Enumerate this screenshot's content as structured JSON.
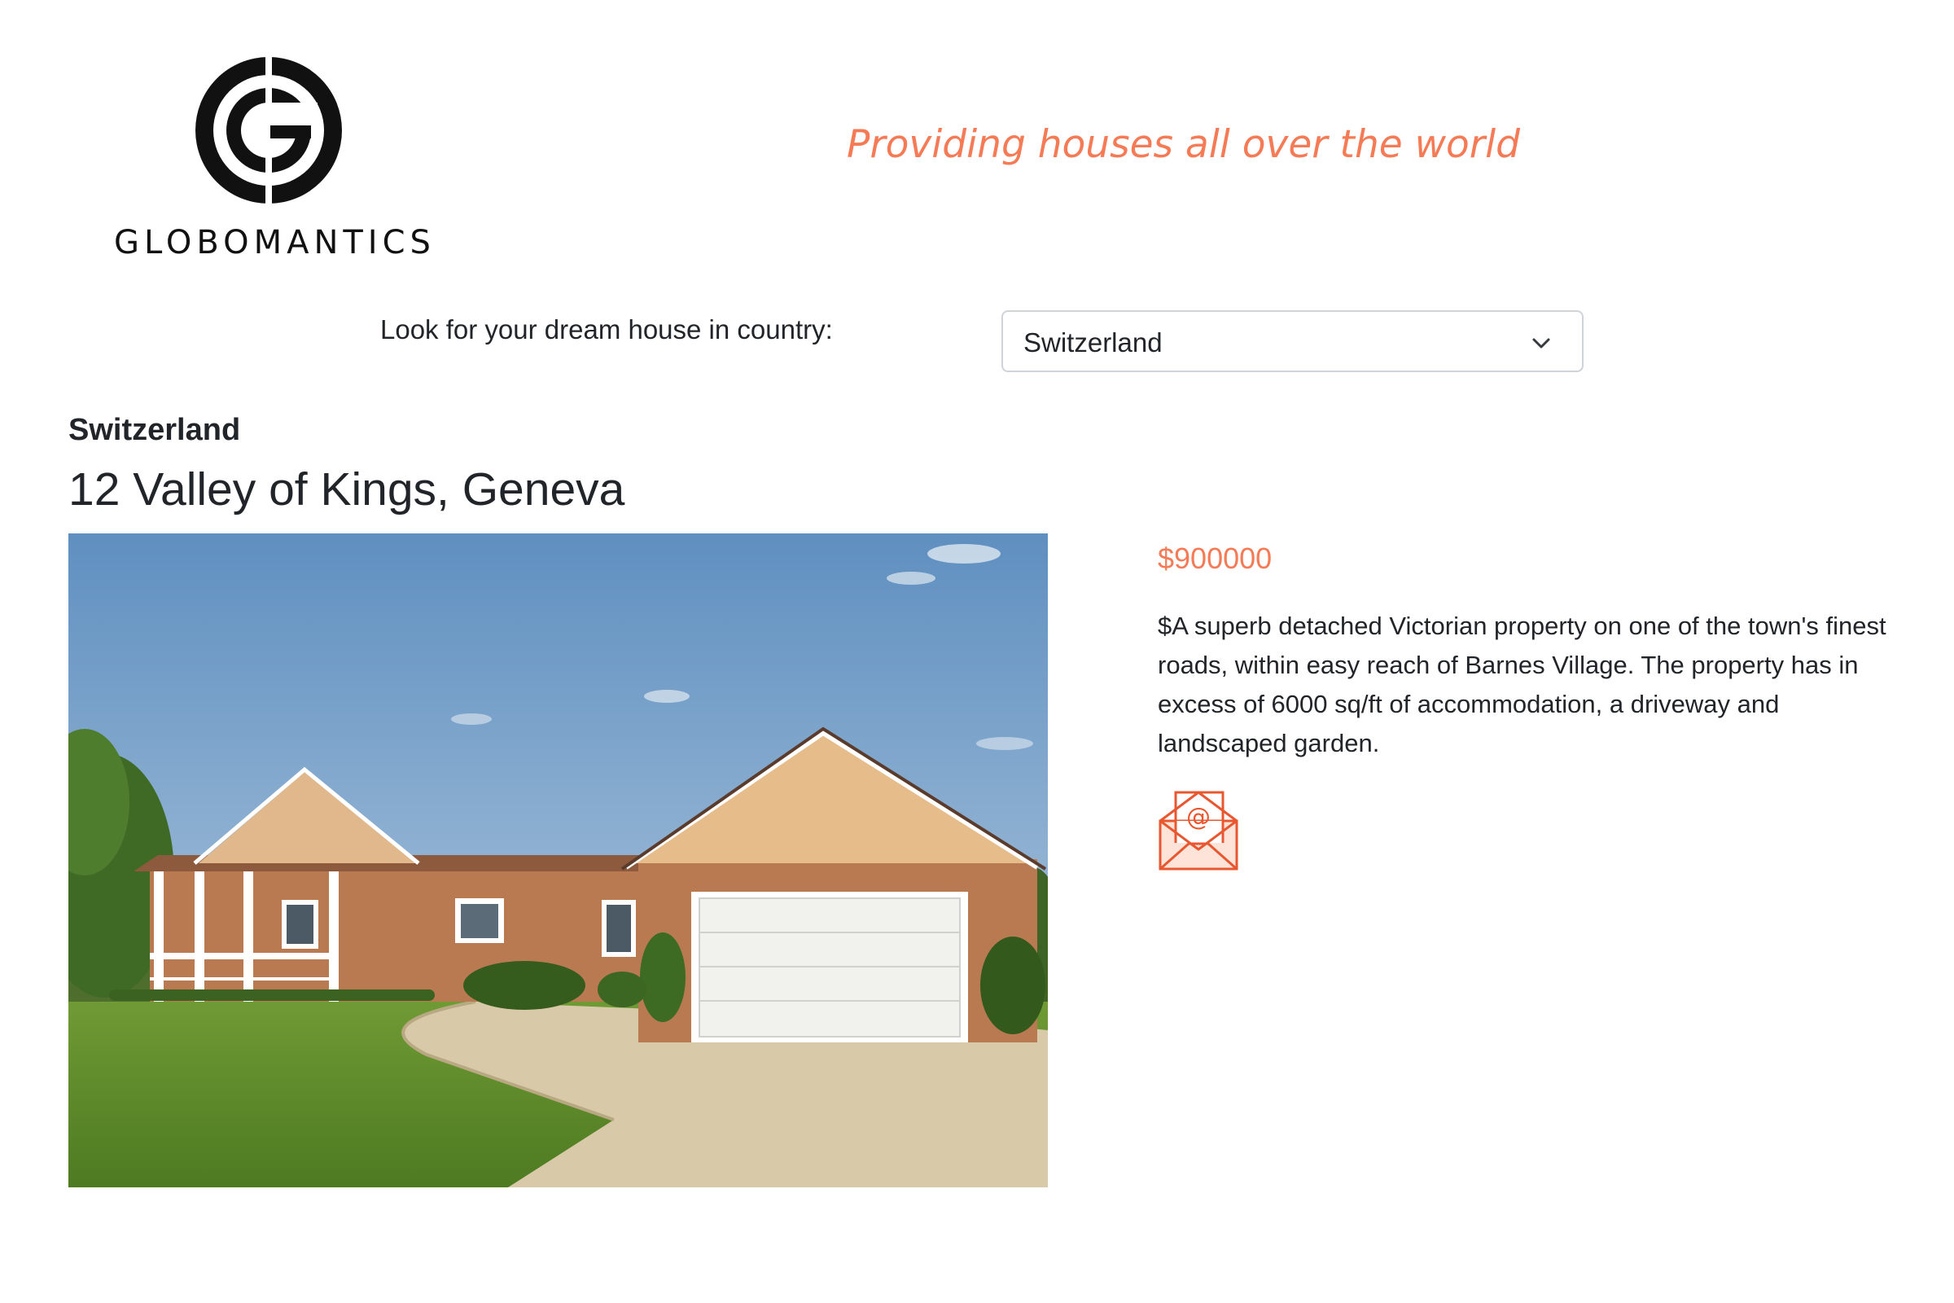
{
  "header": {
    "logo_text": "GLOBOMANTICS",
    "tagline": "Providing houses all over the world"
  },
  "search": {
    "label": "Look for your dream house in country:",
    "selected_country": "Switzerland"
  },
  "listing": {
    "country": "Switzerland",
    "address": "12 Valley of Kings, Geneva",
    "price": "$900000",
    "description": "$A superb detached Victorian property on one of the town's finest roads, within easy reach of Barnes Village. The property has in excess of 6000 sq/ft of accommodation, a driveway and landscaped garden."
  },
  "icons": {
    "logo": "globomantics-logo-icon",
    "dropdown": "chevron-down-icon",
    "contact": "email-envelope-icon"
  },
  "colors": {
    "accent": "#f47b55",
    "text": "#212529",
    "logo": "#111111"
  }
}
